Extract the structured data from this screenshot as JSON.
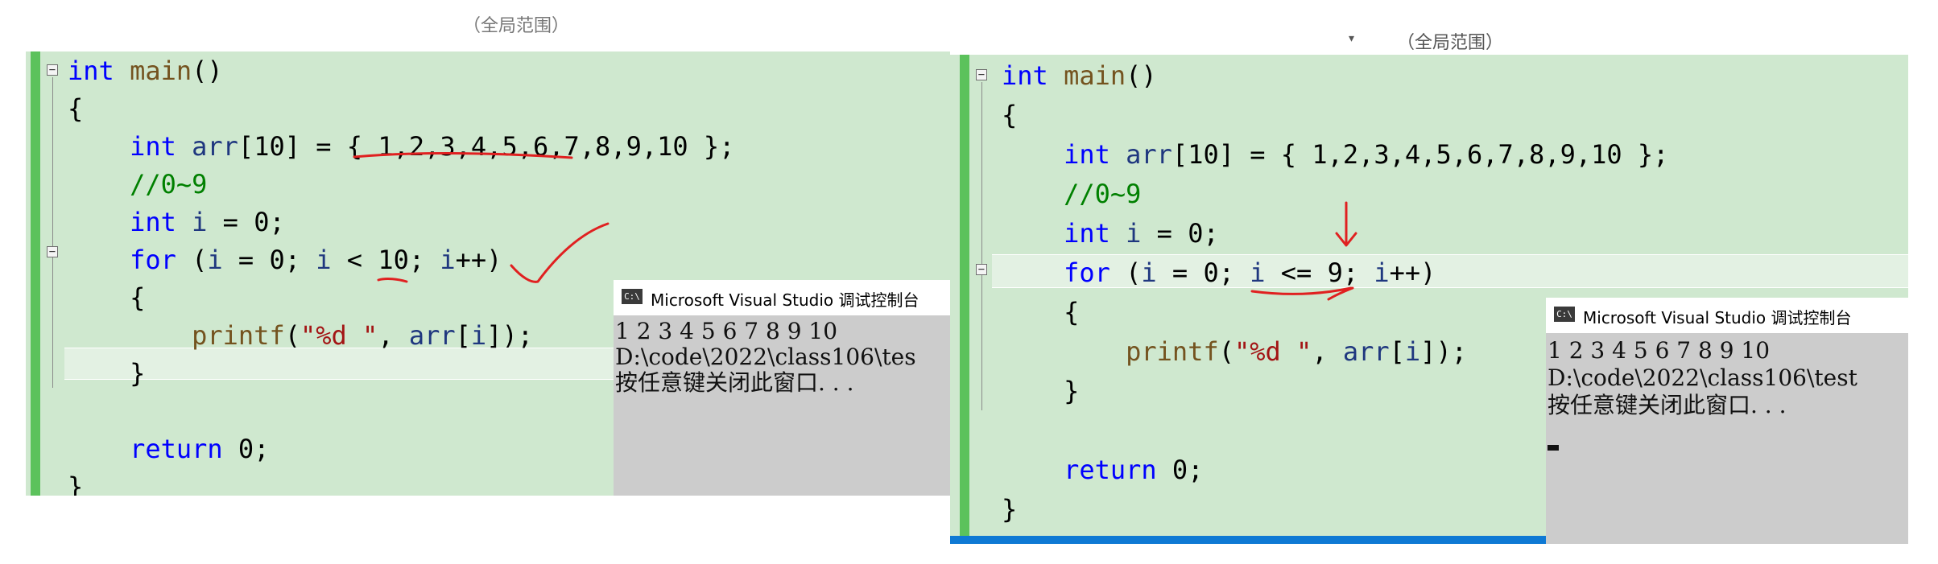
{
  "left_panel": {
    "topbar_text": "（全局范围）",
    "code_lines": [
      {
        "parts": [
          {
            "c": "kw",
            "t": "int"
          },
          {
            "c": "",
            "t": " "
          },
          {
            "c": "fn",
            "t": "main"
          },
          {
            "c": "",
            "t": "()"
          }
        ]
      },
      {
        "parts": [
          {
            "c": "",
            "t": "{"
          }
        ]
      },
      {
        "parts": [
          {
            "c": "",
            "t": "    "
          },
          {
            "c": "kw",
            "t": "int"
          },
          {
            "c": "",
            "t": " "
          },
          {
            "c": "var",
            "t": "arr"
          },
          {
            "c": "",
            "t": "[10] = { 1,2,3,4,5,6,7,8,9,10 };"
          }
        ]
      },
      {
        "parts": [
          {
            "c": "",
            "t": "    "
          },
          {
            "c": "cm",
            "t": "//0~9"
          }
        ]
      },
      {
        "parts": [
          {
            "c": "",
            "t": "    "
          },
          {
            "c": "kw",
            "t": "int"
          },
          {
            "c": "",
            "t": " "
          },
          {
            "c": "var",
            "t": "i"
          },
          {
            "c": "",
            "t": " = 0;"
          }
        ]
      },
      {
        "parts": [
          {
            "c": "",
            "t": "    "
          },
          {
            "c": "kw",
            "t": "for"
          },
          {
            "c": "",
            "t": " ("
          },
          {
            "c": "var",
            "t": "i"
          },
          {
            "c": "",
            "t": " = 0; "
          },
          {
            "c": "var",
            "t": "i"
          },
          {
            "c": "",
            "t": " < 10; "
          },
          {
            "c": "var",
            "t": "i"
          },
          {
            "c": "",
            "t": "++)"
          }
        ]
      },
      {
        "parts": [
          {
            "c": "",
            "t": "    {"
          }
        ]
      },
      {
        "parts": [
          {
            "c": "",
            "t": "        "
          },
          {
            "c": "fn",
            "t": "printf"
          },
          {
            "c": "",
            "t": "("
          },
          {
            "c": "str",
            "t": "\"%d \""
          },
          {
            "c": "",
            "t": ", "
          },
          {
            "c": "var",
            "t": "arr"
          },
          {
            "c": "",
            "t": "["
          },
          {
            "c": "var",
            "t": "i"
          },
          {
            "c": "",
            "t": "]);"
          }
        ]
      },
      {
        "parts": [
          {
            "c": "",
            "t": "    }"
          }
        ]
      },
      {
        "parts": []
      },
      {
        "parts": [
          {
            "c": "",
            "t": "    "
          },
          {
            "c": "kw",
            "t": "return"
          },
          {
            "c": "",
            "t": " 0;"
          }
        ]
      },
      {
        "parts": [
          {
            "c": "",
            "t": "}"
          }
        ]
      }
    ],
    "console": {
      "title": "Microsoft Visual Studio 调试控制台",
      "icon_label": "C:\\",
      "lines": [
        "1 2 3 4 5 6 7 8 9 10",
        "D:\\code\\2022\\class106\\tes",
        "按任意键关闭此窗口. . ."
      ]
    }
  },
  "right_panel": {
    "topbar_text": "（全局范围）",
    "code_lines": [
      {
        "parts": [
          {
            "c": "kw",
            "t": "int"
          },
          {
            "c": "",
            "t": " "
          },
          {
            "c": "fn",
            "t": "main"
          },
          {
            "c": "",
            "t": "()"
          }
        ]
      },
      {
        "parts": [
          {
            "c": "",
            "t": "{"
          }
        ]
      },
      {
        "parts": [
          {
            "c": "",
            "t": "    "
          },
          {
            "c": "kw",
            "t": "int"
          },
          {
            "c": "",
            "t": " "
          },
          {
            "c": "var",
            "t": "arr"
          },
          {
            "c": "",
            "t": "[10] = { 1,2,3,4,5,6,7,8,9,10 };"
          }
        ]
      },
      {
        "parts": [
          {
            "c": "",
            "t": "    "
          },
          {
            "c": "cm",
            "t": "//0~9"
          }
        ]
      },
      {
        "parts": [
          {
            "c": "",
            "t": "    "
          },
          {
            "c": "kw",
            "t": "int"
          },
          {
            "c": "",
            "t": " "
          },
          {
            "c": "var",
            "t": "i"
          },
          {
            "c": "",
            "t": " = 0;"
          }
        ]
      },
      {
        "parts": [
          {
            "c": "",
            "t": "    "
          },
          {
            "c": "kw",
            "t": "for"
          },
          {
            "c": "",
            "t": " ("
          },
          {
            "c": "var",
            "t": "i"
          },
          {
            "c": "",
            "t": " = 0; "
          },
          {
            "c": "var",
            "t": "i"
          },
          {
            "c": "",
            "t": " <= 9; "
          },
          {
            "c": "var",
            "t": "i"
          },
          {
            "c": "",
            "t": "++)"
          }
        ]
      },
      {
        "parts": [
          {
            "c": "",
            "t": "    {"
          }
        ]
      },
      {
        "parts": [
          {
            "c": "",
            "t": "        "
          },
          {
            "c": "fn",
            "t": "printf"
          },
          {
            "c": "",
            "t": "("
          },
          {
            "c": "str",
            "t": "\"%d \""
          },
          {
            "c": "",
            "t": ", "
          },
          {
            "c": "var",
            "t": "arr"
          },
          {
            "c": "",
            "t": "["
          },
          {
            "c": "var",
            "t": "i"
          },
          {
            "c": "",
            "t": "]);"
          }
        ]
      },
      {
        "parts": [
          {
            "c": "",
            "t": "    }"
          }
        ]
      },
      {
        "parts": []
      },
      {
        "parts": [
          {
            "c": "",
            "t": "    "
          },
          {
            "c": "kw",
            "t": "return"
          },
          {
            "c": "",
            "t": " 0;"
          }
        ]
      },
      {
        "parts": [
          {
            "c": "",
            "t": "}"
          }
        ]
      }
    ],
    "console": {
      "title": "Microsoft Visual Studio 调试控制台",
      "icon_label": "C:\\",
      "lines": [
        "1 2 3 4 5 6 7 8 9 10",
        "D:\\code\\2022\\class106\\test",
        "按任意键关闭此窗口. . ."
      ]
    }
  },
  "colors": {
    "editor_bg": "#cfe8cf",
    "keyword": "#0000ff",
    "function": "#74531f",
    "variable": "#1f377f",
    "comment": "#008000",
    "string": "#a31515",
    "gutter_bar": "#5cc25c",
    "annotation_ink": "#e02020",
    "console_bg": "#cccccc"
  },
  "icons": {
    "fold": "collapse-box-icon",
    "console": "console-app-icon"
  }
}
